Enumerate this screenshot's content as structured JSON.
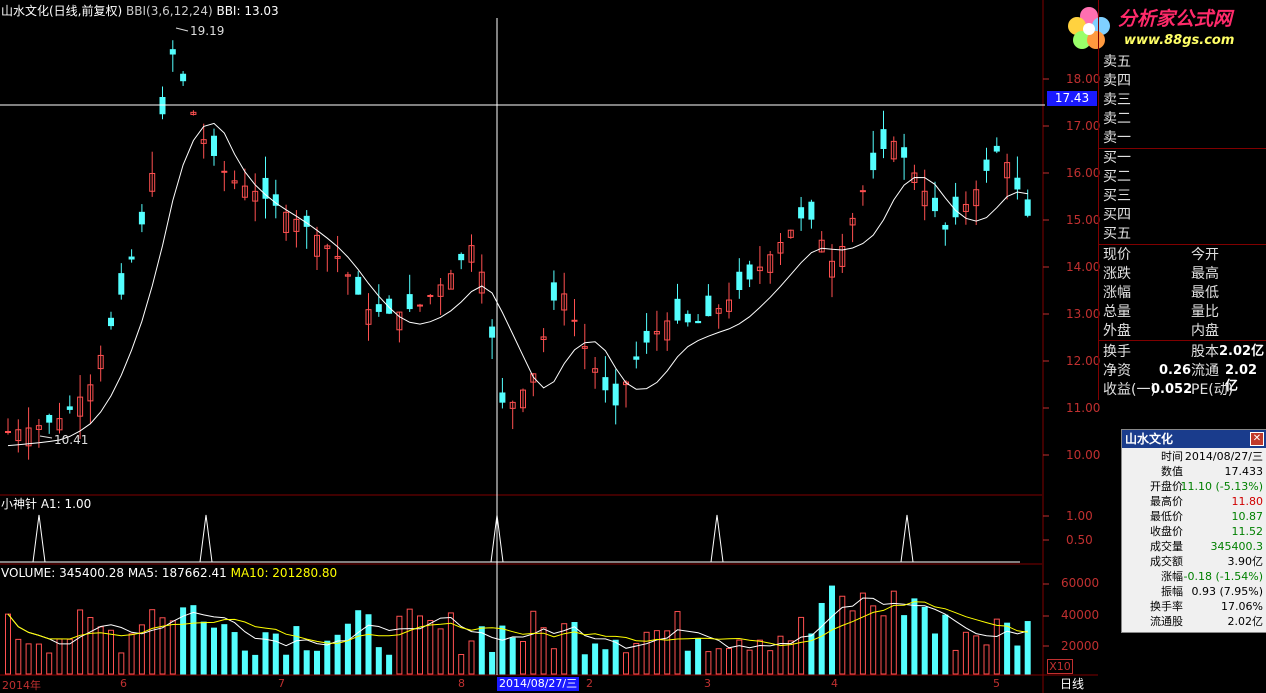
{
  "header": {
    "title": "山水文化(日线,前复权)",
    "indicator": "BBI(3,6,12,24)",
    "bbi_label": "BBI: 13.03"
  },
  "price_axis": {
    "ticks": [
      "18.00",
      "17.00",
      "16.00",
      "15.00",
      "14.00",
      "13.00",
      "12.00",
      "11.00",
      "10.00"
    ],
    "cursor_value": "17.43",
    "high_marker": "19.19",
    "low_marker": "10.41"
  },
  "indicator_panel": {
    "label": "小神针 A1: 1.00",
    "ticks": [
      "1.00",
      "0.50"
    ]
  },
  "volume_panel": {
    "label_volume": "VOLUME: 345400.28",
    "label_ma5": "MA5: 187662.41",
    "label_ma10": "MA10: 201280.80",
    "ticks": [
      "60000",
      "40000",
      "20000"
    ],
    "scale": "X10"
  },
  "x_axis": {
    "labels": [
      "2014年",
      "6",
      "7",
      "8",
      "2",
      "3",
      "4",
      "5"
    ],
    "cursor_date": "2014/08/27/三",
    "period": "日线"
  },
  "quote_panel": {
    "sell": [
      "卖五",
      "卖四",
      "卖三",
      "卖二",
      "卖一"
    ],
    "buy": [
      "买一",
      "买二",
      "买三",
      "买四",
      "买五"
    ],
    "rows_left": [
      "现价",
      "涨跌",
      "涨幅",
      "总量",
      "外盘"
    ],
    "rows_right": [
      "今开",
      "最高",
      "最低",
      "量比",
      "内盘"
    ],
    "huanshou": "换手",
    "guben_label": "股本",
    "guben_value": "2.02亿",
    "jingzi_label": "净资",
    "jingzi_value": "0.26",
    "liutong_label": "流通",
    "liutong_value": "2.02亿",
    "shouyi_label": "收益(一)",
    "shouyi_value": "0.052",
    "pe_label": "PE(动)"
  },
  "logo": {
    "text": "分析家公式网",
    "url": "www.88gs.com"
  },
  "info_popup": {
    "title": "山水文化",
    "close": "✕",
    "rows": [
      {
        "k": "时间",
        "v": "2014/08/27/三",
        "color": "#000000"
      },
      {
        "k": "数值",
        "v": "17.433",
        "color": "#000000"
      },
      {
        "k": "开盘价",
        "v": "11.10 (-5.13%)",
        "color": "#008000"
      },
      {
        "k": "最高价",
        "v": "11.80",
        "color": "#d00000"
      },
      {
        "k": "最低价",
        "v": "10.87",
        "color": "#008000"
      },
      {
        "k": "收盘价",
        "v": "11.52",
        "color": "#008000"
      },
      {
        "k": "成交量",
        "v": "345400.3",
        "color": "#008000"
      },
      {
        "k": "成交额",
        "v": "3.90亿",
        "color": "#000000"
      },
      {
        "k": "涨幅",
        "v": "-0.18 (-1.54%)",
        "color": "#008000"
      },
      {
        "k": "振幅",
        "v": "0.93 (7.95%)",
        "color": "#000000"
      },
      {
        "k": "换手率",
        "v": "17.06%",
        "color": "#000000"
      },
      {
        "k": "流通股",
        "v": "2.02亿",
        "color": "#000000"
      }
    ]
  },
  "chart_data": {
    "type": "candlestick",
    "bars": 100,
    "price_range": [
      9.3,
      19.6
    ],
    "ohlc_approx_start": 10.5,
    "ohlc_approx_peak": 19.19,
    "signal_peaks_at_bar": [
      8,
      41,
      98,
      141,
      179
    ],
    "colors": {
      "up": "#ff5050",
      "down": "#54ffff",
      "bbi": "#ffffff",
      "ma5": "#ffffff",
      "ma10": "#ffff00"
    }
  }
}
